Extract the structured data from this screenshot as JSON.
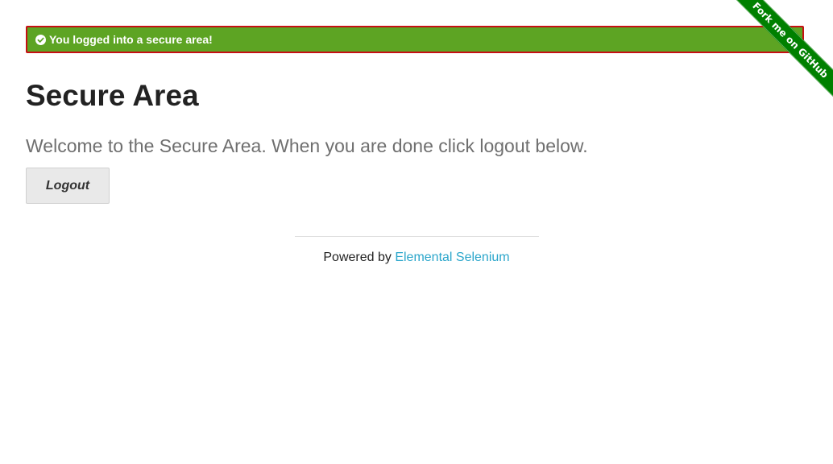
{
  "flash": {
    "message": "You logged into a secure area!",
    "close": "×",
    "icon": "check-circle-icon",
    "bg_color": "#5da423",
    "border_color": "#c60f13"
  },
  "ribbon": {
    "label": "Fork me on GitHub",
    "color": "#008000"
  },
  "page": {
    "title": "Secure Area",
    "subheader": "Welcome to the Secure Area. When you are done click logout below."
  },
  "logout": {
    "label": "Logout"
  },
  "footer": {
    "prefix": "Powered by ",
    "link_label": "Elemental Selenium",
    "link_color": "#2ba6cb"
  }
}
